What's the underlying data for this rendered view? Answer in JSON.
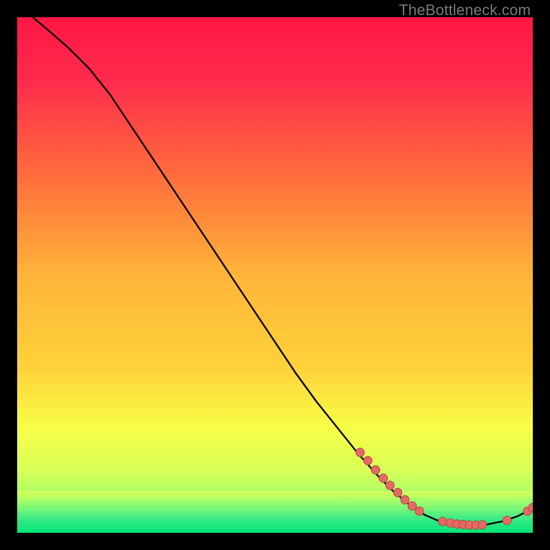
{
  "watermark": "TheBottleneck.com",
  "colors": {
    "bg_black": "#000000",
    "grad_top": "#ff1744",
    "grad_mid1": "#ff6d3a",
    "grad_mid2": "#ffd23a",
    "grad_mid3": "#f7ff47",
    "grad_bottom": "#00e676",
    "curve": "#000000",
    "dot_fill": "#e46a63",
    "dot_stroke": "#b04a45"
  },
  "chart_data": {
    "type": "line",
    "title": "",
    "xlabel": "",
    "ylabel": "",
    "xlim": [
      0,
      100
    ],
    "ylim": [
      0,
      100
    ],
    "grid": false,
    "legend": false,
    "curve_xy": [
      [
        3,
        100
      ],
      [
        6,
        97.5
      ],
      [
        10,
        94
      ],
      [
        14,
        90
      ],
      [
        18,
        85
      ],
      [
        22,
        79
      ],
      [
        26,
        73
      ],
      [
        30,
        67
      ],
      [
        34,
        61
      ],
      [
        38,
        55
      ],
      [
        42,
        49
      ],
      [
        46,
        43
      ],
      [
        50,
        37
      ],
      [
        54,
        31
      ],
      [
        58,
        25.5
      ],
      [
        62,
        20.5
      ],
      [
        66,
        15.5
      ],
      [
        70,
        11
      ],
      [
        73,
        8
      ],
      [
        76,
        5.5
      ],
      [
        79,
        3.5
      ],
      [
        82,
        2.2
      ],
      [
        85,
        1.6
      ],
      [
        88,
        1.4
      ],
      [
        91,
        1.6
      ],
      [
        94,
        2.2
      ],
      [
        97,
        3.2
      ],
      [
        99,
        4.2
      ],
      [
        100,
        4.8
      ]
    ],
    "dots_xy": [
      [
        66.5,
        15.6
      ],
      [
        68.0,
        14.0
      ],
      [
        69.5,
        12.2
      ],
      [
        71.0,
        10.6
      ],
      [
        72.3,
        9.2
      ],
      [
        73.8,
        7.8
      ],
      [
        75.2,
        6.4
      ],
      [
        76.6,
        5.2
      ],
      [
        78.0,
        4.2
      ],
      [
        82.5,
        2.2
      ],
      [
        84.0,
        1.9
      ],
      [
        85.3,
        1.7
      ],
      [
        86.5,
        1.6
      ],
      [
        87.7,
        1.5
      ],
      [
        89.0,
        1.5
      ],
      [
        90.2,
        1.55
      ],
      [
        95.0,
        2.4
      ],
      [
        99.0,
        4.2
      ],
      [
        100.0,
        4.9
      ]
    ],
    "gradient_band_y": [
      80,
      100
    ],
    "green_band_y": [
      95,
      100
    ]
  }
}
